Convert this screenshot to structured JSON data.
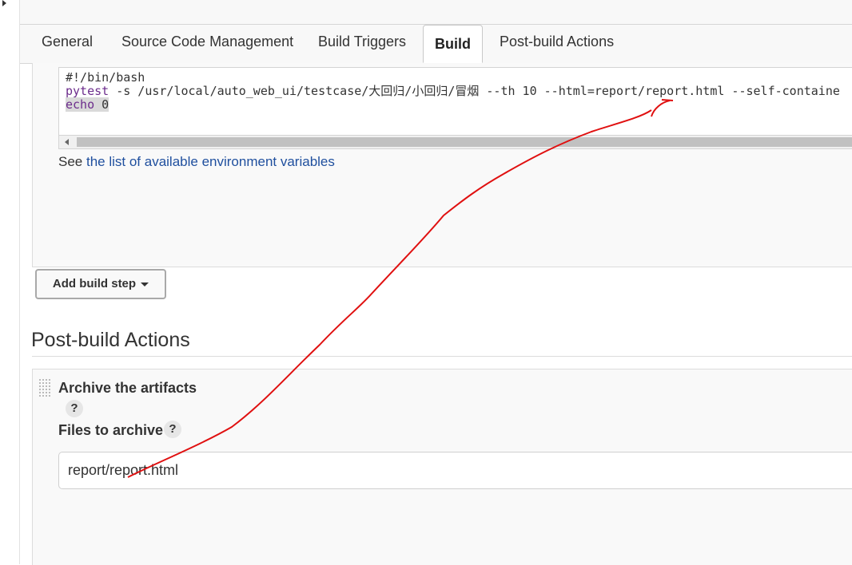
{
  "tabs": [
    {
      "label": "General"
    },
    {
      "label": "Source Code Management"
    },
    {
      "label": "Build Triggers"
    },
    {
      "label": "Build"
    },
    {
      "label": "Post-build Actions"
    }
  ],
  "build": {
    "script": {
      "line1": "#!/bin/bash",
      "line2_cmd": "pytest",
      "line2_rest": " -s /usr/local/auto_web_ui/testcase/大回归/小回归/冒烟 --th 10 --html=report/report.html --self-containe",
      "line3_kw": "echo",
      "line3_rest": " 0"
    },
    "env_prefix": "See ",
    "env_link": "the list of available environment variables",
    "add_step_label": "Add build step"
  },
  "post_build": {
    "title": "Post-build Actions",
    "archive_title": "Archive the artifacts",
    "files_label": "Files to archive",
    "help_glyph": "?",
    "files_value": "report/report.html"
  },
  "colors": {
    "link": "#1f4f9e",
    "annotation": "#e01010",
    "keyword": "#6c2c8c"
  },
  "icons": {
    "collapse": "triangle-right-icon",
    "scroll_left": "triangle-left-icon",
    "dropdown": "caret-down-icon",
    "drag": "drag-handle-icon",
    "help": "help-icon"
  }
}
